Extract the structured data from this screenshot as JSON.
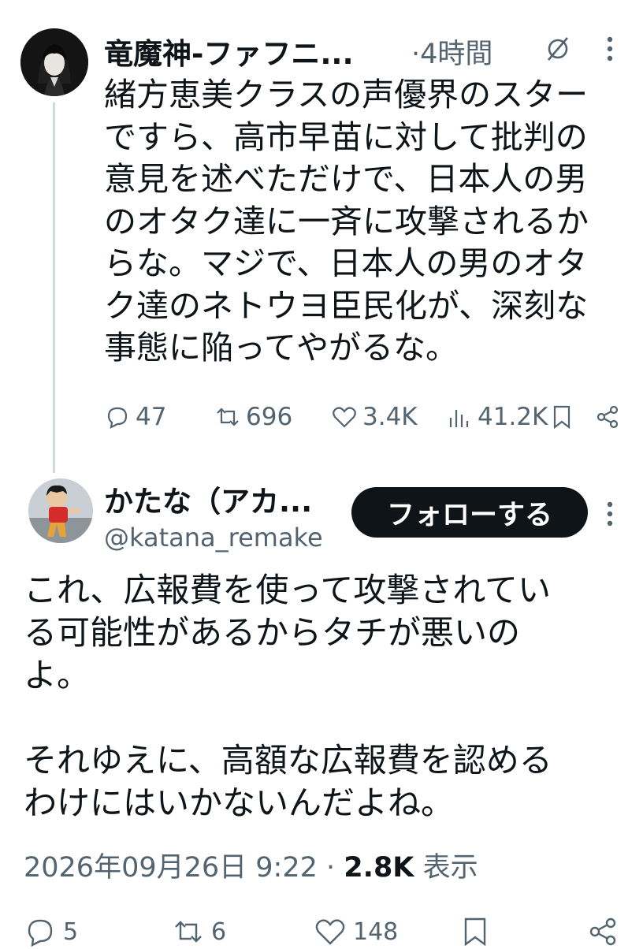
{
  "tweet1": {
    "author_name": "竜魔神-ファフニ...",
    "time": "·4時間",
    "text": "緒方恵美クラスの声優界のスター\nですら、高市早苗に対して批判の\n意見を述べただけで、日本人の男\nのオタク達に一斉に攻撃されるか\nらな。マジで、日本人の男のオタ\nク達のネトウヨ臣民化が、深刻な\n事態に陥ってやがるな。",
    "replies": "47",
    "reposts": "696",
    "likes": "3.4K",
    "views": "41.2K"
  },
  "tweet2": {
    "author_name": "かたな（アカ...",
    "handle": "@katana_remake",
    "follow_label": "フォローする",
    "text": "これ、広報費を使って攻撃されてい\nる可能性があるからタチが悪いの\nよ。\n\nそれゆえに、高額な広報費を認める\nわけにはいかないんだよね。",
    "timestamp": "2026年09月26日 9:22",
    "separator": "·",
    "views_count": "2.8K",
    "views_label": "表示",
    "replies": "5",
    "reposts": "6",
    "likes": "148"
  },
  "colors": {
    "text": "#0f1419",
    "muted": "#536471",
    "thread_line": "#cfd9de",
    "button_bg": "#0f1419"
  },
  "icons": [
    "reply-icon",
    "repost-icon",
    "like-icon",
    "views-icon",
    "bookmark-icon",
    "share-icon",
    "more-icon",
    "grok-icon"
  ]
}
